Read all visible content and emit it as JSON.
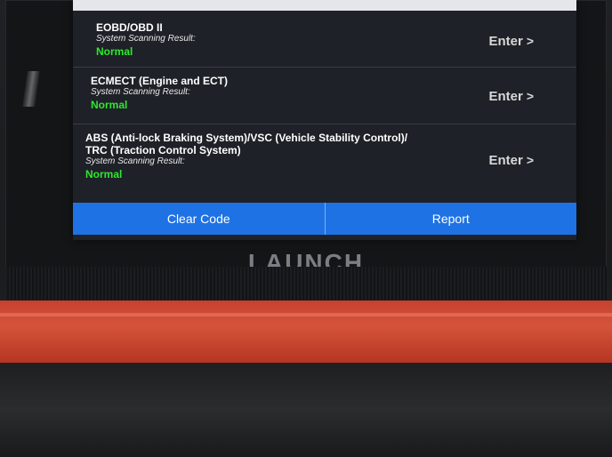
{
  "device": {
    "brand": "LAUNCH"
  },
  "systems": [
    {
      "name": "EOBD/OBD II",
      "sub_label": "System Scanning Result:",
      "status": "Normal",
      "action": "Enter"
    },
    {
      "name": "ECMECT (Engine and ECT)",
      "sub_label": "System Scanning Result:",
      "status": "Normal",
      "action": "Enter"
    },
    {
      "name_line1": "ABS (Anti-lock Braking System)/VSC (Vehicle Stability Control)/",
      "name_line2": "TRC (Traction Control System)",
      "sub_label": "System Scanning Result:",
      "status": "Normal",
      "action": "Enter"
    }
  ],
  "buttons": {
    "clear": "Clear Code",
    "report": "Report"
  },
  "colors": {
    "status_ok": "#2ee82e",
    "button_blue": "#1e72e4",
    "rubber_case": "#d5533a"
  },
  "icons": {
    "enter": "chevron-right-icon"
  }
}
